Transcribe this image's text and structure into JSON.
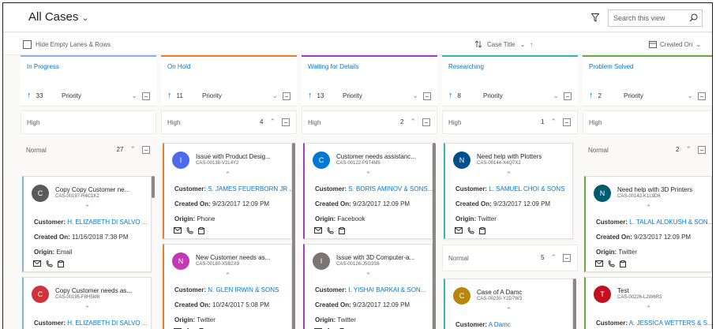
{
  "header": {
    "view_title": "All Cases",
    "search_placeholder": "Search this view"
  },
  "toolbar": {
    "hide_label": "Hide Empty Lanes & Rows",
    "sort_label": "Case Title",
    "created_label": "Created On"
  },
  "labels": {
    "customer": "Customer:",
    "created_on": "Created On:",
    "origin": "Origin:"
  },
  "colors": {
    "in_progress": "#8ab4d8",
    "on_hold": "#e87c2f",
    "waiting": "#9d3fbf",
    "researching": "#35b7b0",
    "solved": "#6ba83f"
  },
  "lanes": [
    {
      "name": "In Progress",
      "count": "33",
      "sort": "Priority",
      "bands": [
        {
          "label": "High",
          "count": ""
        },
        {
          "label": "Normal",
          "count": "27"
        }
      ],
      "cards": [
        {
          "initial": "C",
          "color": "#5b5b5b",
          "title": "Copy Copy Customer ne...",
          "number": "CAS-00197-R4C1K2",
          "customer": "H. ELIZABETH DI SALVO ...",
          "created": "11/16/2018 7:38 PM",
          "origin": "Email"
        },
        {
          "initial": "C",
          "color": "#d13438",
          "title": "Copy Customer needs as...",
          "number": "CAS-00195-F8H5M8",
          "customer": "H. ELIZABETH DI SALVO ...",
          "created": "",
          "origin": ""
        }
      ]
    },
    {
      "name": "On Hold",
      "count": "11",
      "sort": "Priority",
      "bands": [
        {
          "label": "High",
          "count": "4"
        }
      ],
      "cards": [
        {
          "initial": "I",
          "color": "#4f6bed",
          "title": "Issue with Product Desig...",
          "number": "CAS-00138-V2L4Y2",
          "customer": "S. JAMES FEUERBORN JR ...",
          "created": "9/23/2017 12:09 PM",
          "origin": "Phone"
        },
        {
          "initial": "N",
          "color": "#c239b3",
          "title": "New Customer needs as...",
          "number": "CAS-00180-X5B2X9",
          "customer": "N. GLEN IRWIN & SONS",
          "created": "10/24/2017 5:08 PM",
          "origin": "Twitter"
        }
      ]
    },
    {
      "name": "Waiting for Details",
      "count": "13",
      "sort": "Priority",
      "bands": [
        {
          "label": "High",
          "count": "2"
        }
      ],
      "cards": [
        {
          "initial": "C",
          "color": "#0078d4",
          "title": "Customer needs assistanc...",
          "number": "CAS-00122-P9T4M5",
          "customer": "S. BORIS AMINOV & SONS...",
          "created": "9/23/2017 12:09 PM",
          "origin": "Facebook"
        },
        {
          "initial": "I",
          "color": "#7a7574",
          "title": "Issue with 3D Computer-a...",
          "number": "CAS-00126-J5G3S6",
          "customer": "I. YISHAI BARKAI & SON...",
          "created": "9/23/2017 12:09 PM",
          "origin": "Twitter"
        }
      ]
    },
    {
      "name": "Researching",
      "count": "8",
      "sort": "Priority",
      "bands": [
        {
          "label": "High",
          "count": "1"
        },
        {
          "label": "Normal",
          "count": "5"
        }
      ],
      "cards": [
        {
          "initial": "N",
          "color": "#004e8c",
          "title": "Need help with Plotters",
          "number": "CAS-00144-X4Q7X2",
          "customer": "L. SAMUEL CHOI & SONS",
          "created": "9/23/2017 12:09 PM",
          "origin": "Twitter"
        },
        {
          "initial": "C",
          "color": "#b8860b",
          "title": "Case of A Damc",
          "number": "CAS-00230-Y2D7W3",
          "customer": "A Damc",
          "created": "",
          "origin": ""
        }
      ]
    },
    {
      "name": "Problem Solved",
      "count": "2",
      "sort": "Priority",
      "bands": [
        {
          "label": "High",
          "count": ""
        },
        {
          "label": "Normal",
          "count": "2"
        }
      ],
      "cards": [
        {
          "initial": "N",
          "color": "#005b70",
          "title": "Need help with 3D Printers",
          "number": "CAS-00142-K1L9D6",
          "customer": "L. TALAL ALOKUSH & SON...",
          "created": "9/23/2017 12:09 PM",
          "origin": "Twitter"
        },
        {
          "initial": "T",
          "color": "#c50f1f",
          "title": "Test",
          "number": "CAS-00226-L2W6R3",
          "customer": "A. JESSICA WETTERS & S...",
          "created": "",
          "origin": ""
        }
      ]
    }
  ]
}
